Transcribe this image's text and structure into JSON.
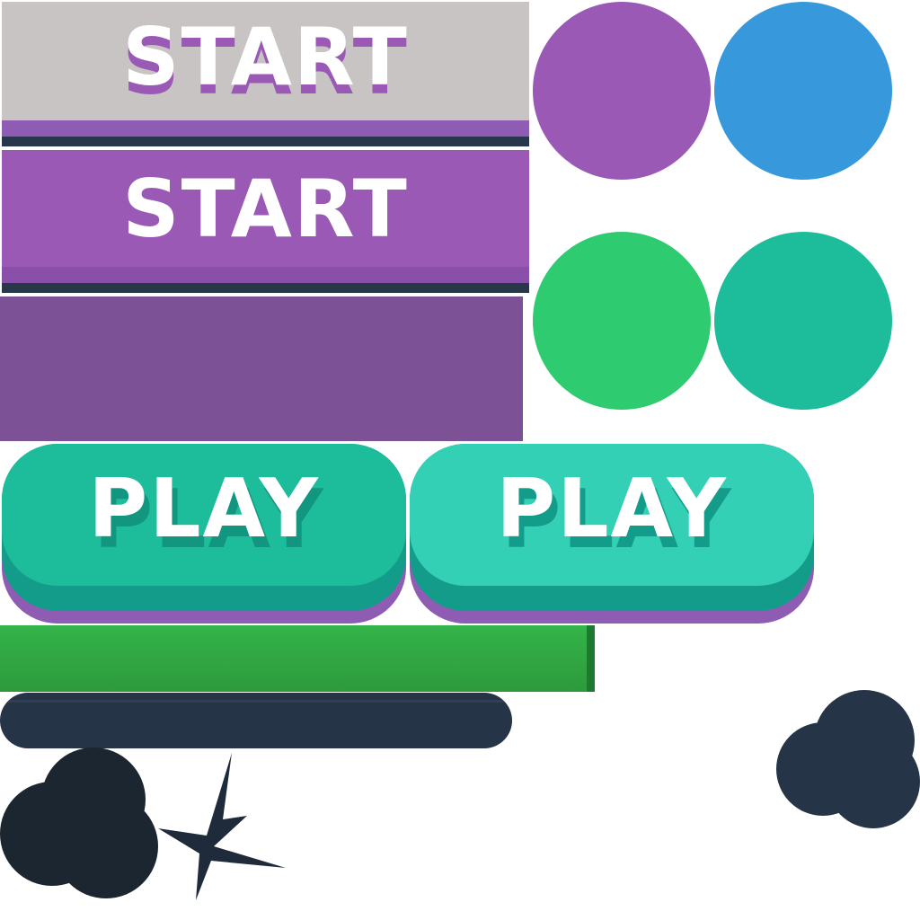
{
  "start_buttons": [
    {
      "label": "START",
      "state": "pressed",
      "face_color": "#c7c4c3",
      "lip_color": "#8e5cb3",
      "text_shadow_color": "#9b59b6"
    },
    {
      "label": "START",
      "state": "normal",
      "face_color": "#9b59b6",
      "lip_color": "#8a4fa8",
      "text_shadow_color": "#8a4fa8"
    }
  ],
  "panel": {
    "color": "#7d5195"
  },
  "play_buttons": [
    {
      "label": "PLAY",
      "state": "normal",
      "top_color": "#1dbd9b",
      "side_color": "#149c8a",
      "text_shadow_color": "#13967f"
    },
    {
      "label": "PLAY",
      "state": "hover",
      "top_color": "#34d0b6",
      "side_color": "#149c8a",
      "text_shadow_color": "#149c8a"
    }
  ],
  "color_swatches": [
    "#9b59b6",
    "#3799db",
    "#2ecb70",
    "#1dbc9b"
  ],
  "progress_bar": {
    "fill_color": "#34b44a",
    "edge_color": "#1e7a30",
    "progress": 1.0
  },
  "track_bar": {
    "color": "#263447"
  },
  "decorations": {
    "smoke_cloud_left_color": "#1c2631",
    "smoke_cloud_right_color": "#263447",
    "burst_color": "#1f2b3a"
  }
}
